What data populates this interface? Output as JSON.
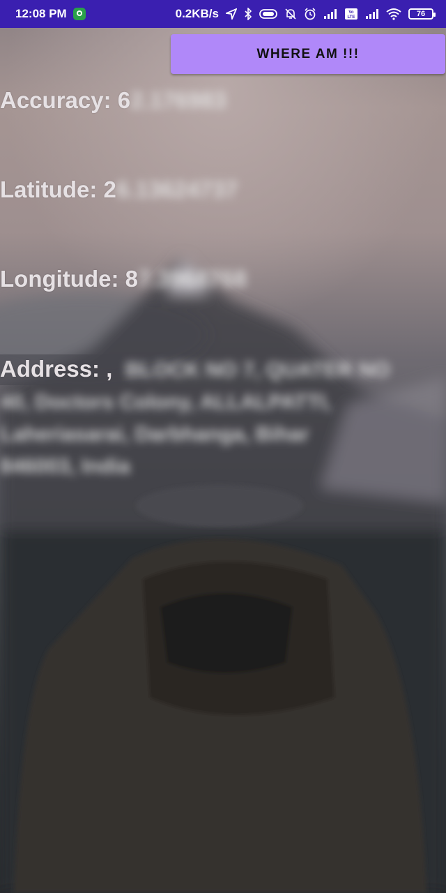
{
  "status_bar": {
    "time": "12:08 PM",
    "net_speed": "0.2KB/s",
    "battery": "76",
    "icons": [
      "location-app-icon",
      "navigation-icon",
      "bluetooth-icon",
      "toggle-icon",
      "mute-icon",
      "alarm-icon",
      "signal-icon",
      "volte-icon",
      "signal-icon",
      "wifi-icon",
      "battery-icon"
    ]
  },
  "button": {
    "label": "WHERE AM !!!"
  },
  "accuracy": {
    "label": "Accuracy: 6",
    "hidden": "2.176983"
  },
  "latitude": {
    "label": "Latitude: 2",
    "hidden": "6.13624737"
  },
  "longitude": {
    "label": "Longitude: 8",
    "hidden": "7.3968768"
  },
  "address": {
    "label": "Address: ,",
    "hidden": "BLOCK NO 7, QUATER NO 40, Doctors Colony, ALLALPATTI, Laheriasarai, Darbhanga, Bihar 846003, India"
  },
  "colors": {
    "status_bar": "#3a1fb0",
    "button": "#b088f9"
  }
}
